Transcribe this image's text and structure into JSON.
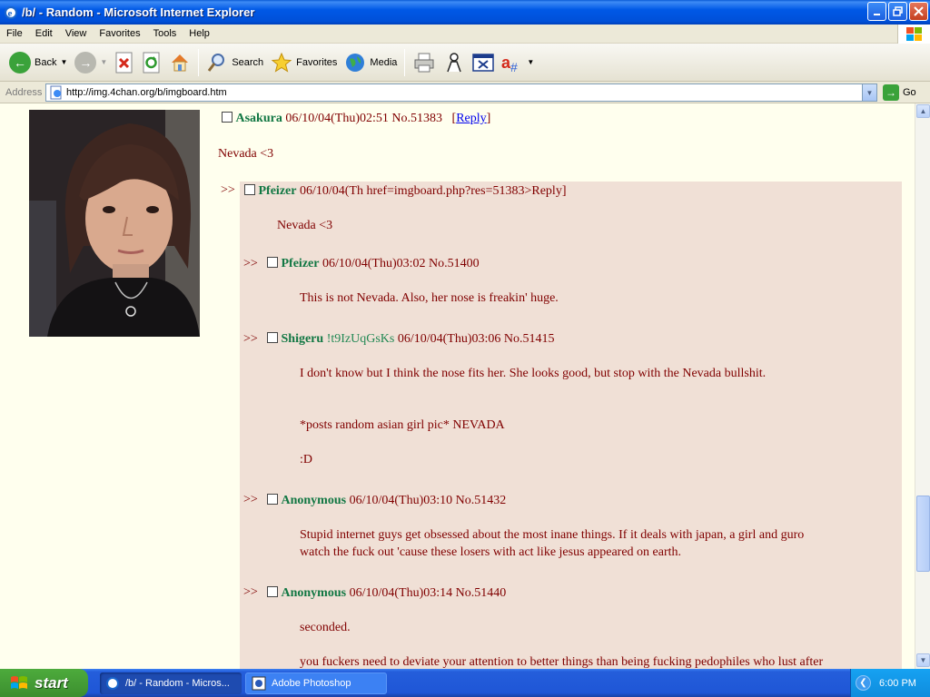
{
  "window": {
    "title": "/b/ - Random - Microsoft Internet Explorer"
  },
  "menu": [
    "File",
    "Edit",
    "View",
    "Favorites",
    "Tools",
    "Help"
  ],
  "toolbar": {
    "back": "Back",
    "search": "Search",
    "favorites": "Favorites",
    "media": "Media"
  },
  "address": {
    "label": "Address",
    "url": "http://img.4chan.org/b/imgboard.htm",
    "go": "Go"
  },
  "thread": {
    "op": {
      "name": "Asakura",
      "datetime": "06/10/04(Thu)02:51",
      "number": "No.51383",
      "reply_link": "Reply",
      "message": "Nevada <3"
    },
    "replies": [
      {
        "arrows": ">>",
        "name": "Pfeizer",
        "header_rest": "06/10/04(Th href=imgboard.php?res=51383>Reply]",
        "lines": [
          "Nevada <3"
        ]
      },
      {
        "arrows": ">>",
        "name": "Pfeizer",
        "datetime": "06/10/04(Thu)03:02",
        "number": "No.51400",
        "lines": [
          "This is not Nevada. Also, her nose is freakin' huge."
        ]
      },
      {
        "arrows": ">>",
        "name": "Shigeru",
        "trip": "!t9IzUqGsKs",
        "datetime": "06/10/04(Thu)03:06",
        "number": "No.51415",
        "lines": [
          "I don't know but I think the nose fits her. She looks good, but stop with the Nevada bullshit.",
          "*posts random asian girl pic* NEVADA",
          ":D"
        ]
      },
      {
        "arrows": ">>",
        "name": "Anonymous",
        "datetime": "06/10/04(Thu)03:10",
        "number": "No.51432",
        "lines": [
          "Stupid internet guys get obsessed about the most inane things. If it deals with japan, a girl and guro",
          "watch the fuck out 'cause these losers with act like jesus appeared on earth."
        ]
      },
      {
        "arrows": ">>",
        "name": "Anonymous",
        "datetime": "06/10/04(Thu)03:14",
        "number": "No.51440",
        "lines": [
          "seconded.",
          "you fuckers need to deviate your attention to better things than being fucking pedophiles who lust after"
        ]
      }
    ]
  },
  "taskbar": {
    "start": "start",
    "tasks": [
      "/b/ - Random - Micros...",
      "Adobe Photoshop"
    ],
    "clock": "6:00 PM"
  },
  "colors": {
    "background": "#ffffee",
    "reply_background": "#f0e0d6",
    "text": "#800000",
    "name": "#117743",
    "titlebar": "#0058e6"
  }
}
